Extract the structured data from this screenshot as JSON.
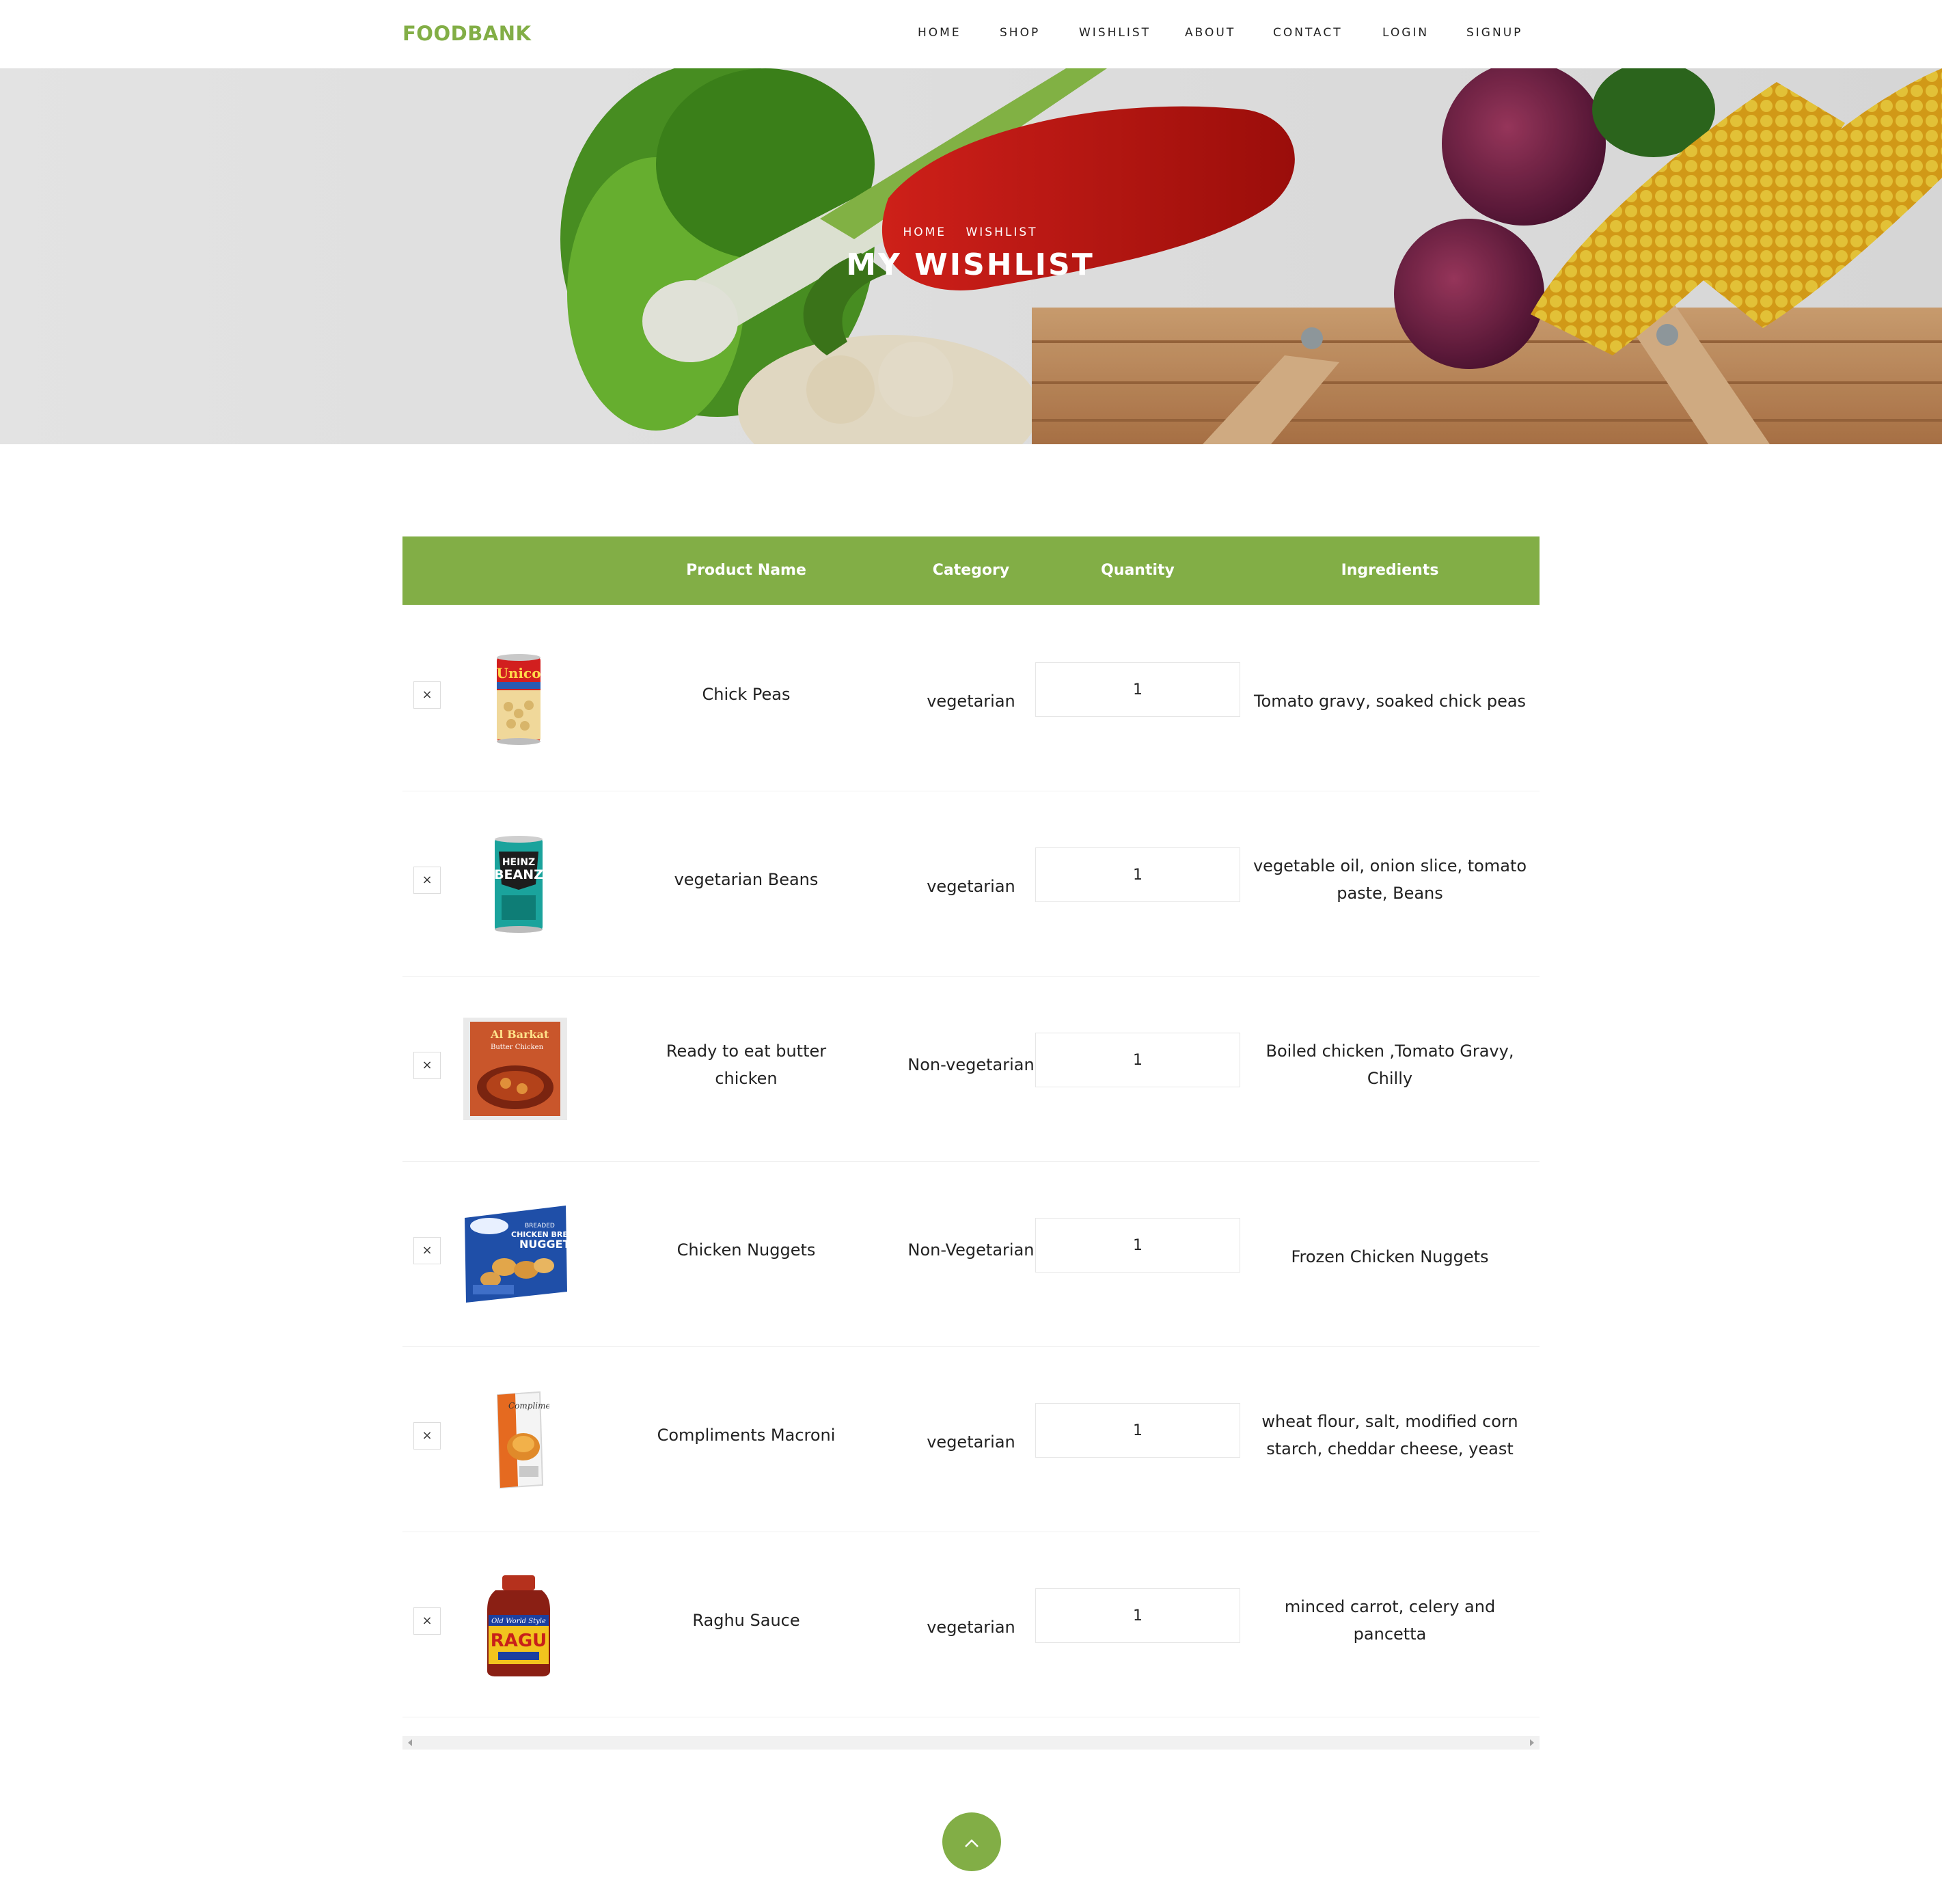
{
  "brand": "FOODBANK",
  "nav": [
    "HOME",
    "SHOP",
    "WISHLIST",
    "ABOUT",
    "CONTACT",
    "LOGIN",
    "SIGNUP"
  ],
  "hero": {
    "breadcrumb_home": "HOME",
    "breadcrumb_current": "WISHLIST",
    "title": "MY WISHLIST"
  },
  "table": {
    "headers": {
      "product_name": "Product Name",
      "category": "Category",
      "quantity": "Quantity",
      "ingredients": "Ingredients"
    },
    "rows": [
      {
        "name": "Chick Peas",
        "category": "vegetarian",
        "quantity": "1",
        "ingredients": "Tomato gravy, soaked chick peas",
        "image": "unico-chick-peas-can"
      },
      {
        "name": "vegetarian Beans",
        "category": "vegetarian",
        "quantity": "1",
        "ingredients": "vegetable oil, onion slice, tomato paste, Beans",
        "image": "heinz-beanz-can"
      },
      {
        "name": "Ready to eat butter chicken",
        "category": "Non-vegetarian",
        "quantity": "1",
        "ingredients": "Boiled chicken ,Tomato Gravy, Chilly",
        "image": "butter-chicken-pack"
      },
      {
        "name": "Chicken Nuggets",
        "category": "Non-Vegetarian",
        "quantity": "1",
        "ingredients": "Frozen Chicken Nuggets",
        "image": "chicken-nuggets-box"
      },
      {
        "name": "Compliments Macroni",
        "category": "vegetarian",
        "quantity": "1",
        "ingredients": "wheat flour, salt, modified corn starch, cheddar cheese, yeast",
        "image": "compliments-macaroni-box"
      },
      {
        "name": "Raghu Sauce",
        "category": "vegetarian",
        "quantity": "1",
        "ingredients": "minced carrot, celery and pancetta",
        "image": "ragu-sauce-jar"
      }
    ],
    "remove_glyph": "×"
  },
  "scroll_top_icon": "chevron-up-icon",
  "colors": {
    "accent": "#82ae46",
    "text": "#222222",
    "border": "#e6e6e6"
  }
}
